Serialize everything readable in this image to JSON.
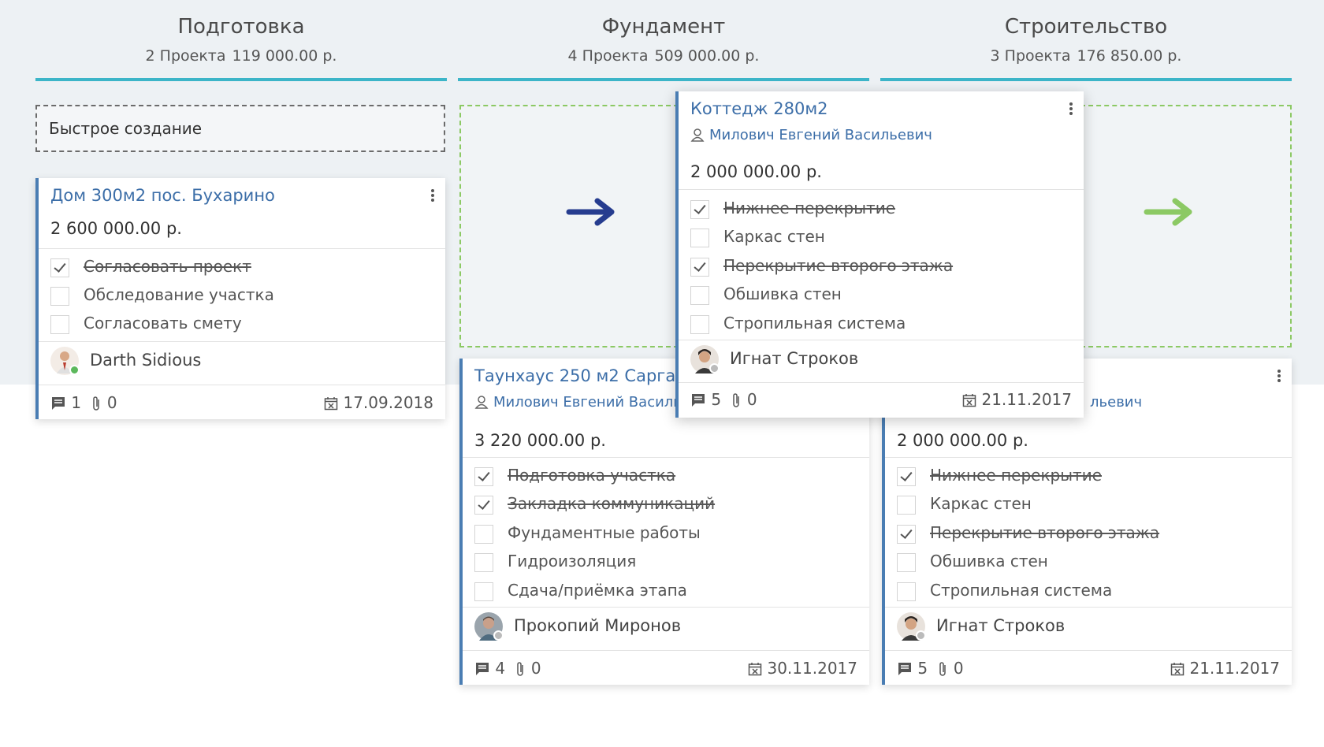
{
  "columns": [
    {
      "title": "Подготовка",
      "count": "2 Проекта",
      "sum": "119 000.00 р."
    },
    {
      "title": "Фундамент",
      "count": "4 Проекта",
      "sum": "509 000.00 р."
    },
    {
      "title": "Строительство",
      "count": "3 Проекта",
      "sum": "176 850.00 р."
    }
  ],
  "quick_create": "Быстрое создание",
  "accent_color": "#3cb5c8",
  "drop_arrows": {
    "left_color": "#263c8f",
    "right_color": "#8cc964"
  },
  "cards": {
    "c1": {
      "title": "Дом 300м2 пос. Бухарино",
      "amount": "2 600 000.00 р.",
      "tasks": [
        {
          "text": "Согласовать проект",
          "done": true
        },
        {
          "text": "Обследование участка",
          "done": false
        },
        {
          "text": "Согласовать смету",
          "done": false
        }
      ],
      "assignee": "Darth Sidious",
      "comments": "1",
      "files": "0",
      "date": "17.09.2018"
    },
    "c2": {
      "title": "Таунхаус 250 м2 Саргазы",
      "person": "Милович Евгений Васильевич",
      "amount": "3 220 000.00 р.",
      "tasks": [
        {
          "text": "Подготовка участка",
          "done": true
        },
        {
          "text": "Закладка коммуникаций",
          "done": true
        },
        {
          "text": "Фундаментные работы",
          "done": false
        },
        {
          "text": "Гидроизоляция",
          "done": false
        },
        {
          "text": "Сдача/приёмка этапа",
          "done": false
        }
      ],
      "assignee": "Прокопий Миронов",
      "comments": "4",
      "files": "0",
      "date": "30.11.2017"
    },
    "c3": {
      "person_visible_part": "льевич",
      "amount": "2 000 000.00 р.",
      "tasks": [
        {
          "text": "Нижнее перекрытие",
          "done": true
        },
        {
          "text": "Каркас стен",
          "done": false
        },
        {
          "text": "Перекрытие второго этажа",
          "done": true
        },
        {
          "text": "Обшивка стен",
          "done": false
        },
        {
          "text": "Стропильная система",
          "done": false
        }
      ],
      "assignee": "Игнат Строков",
      "comments": "5",
      "files": "0",
      "date": "21.11.2017"
    },
    "drag": {
      "title": "Коттедж 280м2",
      "person": "Милович Евгений Васильевич",
      "amount": "2 000 000.00 р.",
      "tasks": [
        {
          "text": "Нижнее перекрытие",
          "done": true
        },
        {
          "text": "Каркас стен",
          "done": false
        },
        {
          "text": "Перекрытие второго этажа",
          "done": true
        },
        {
          "text": "Обшивка стен",
          "done": false
        },
        {
          "text": "Стропильная система",
          "done": false
        }
      ],
      "assignee": "Игнат Строков",
      "comments": "5",
      "files": "0",
      "date": "21.11.2017"
    }
  }
}
